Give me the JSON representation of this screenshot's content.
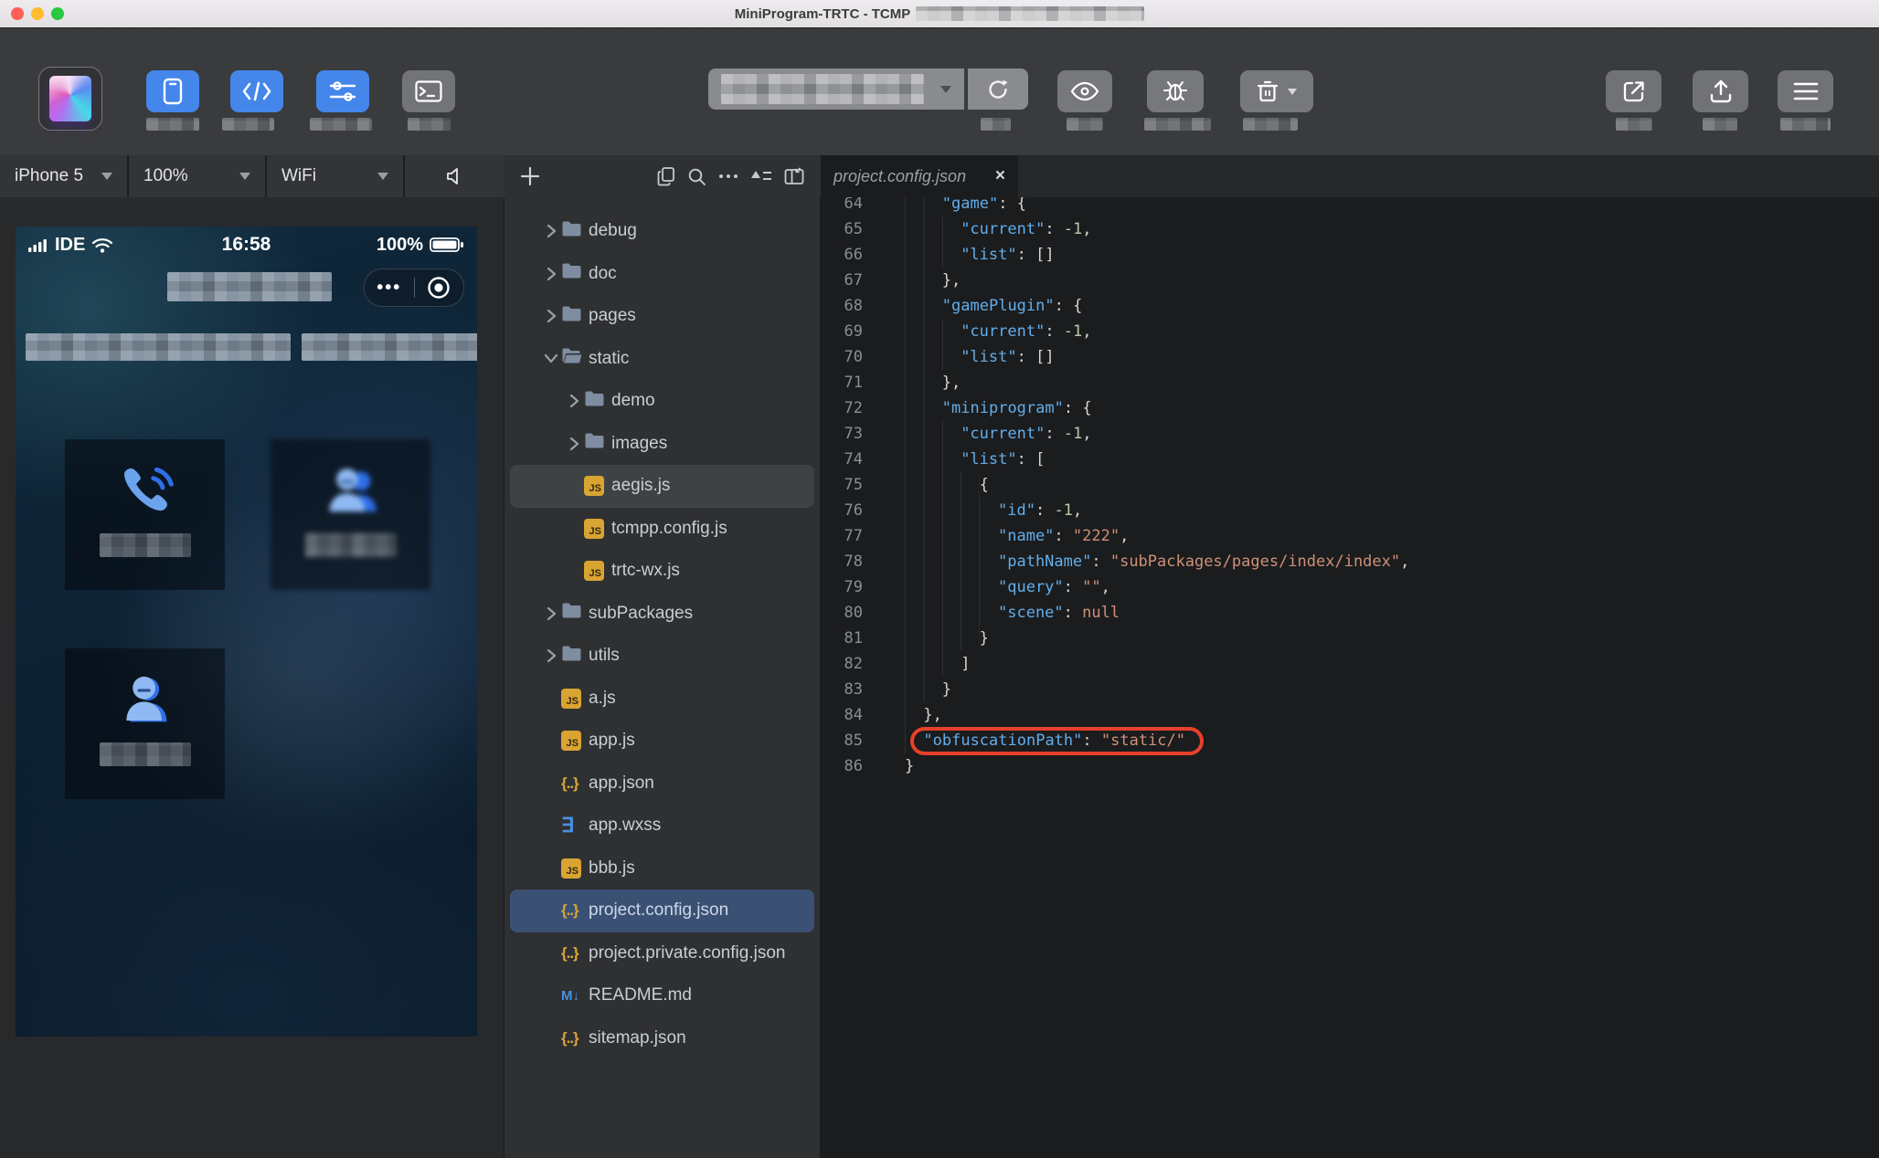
{
  "window": {
    "title": "MiniProgram-TRTC - TCMP",
    "traffic_lights": [
      "close",
      "minimize",
      "zoom"
    ]
  },
  "colors": {
    "accent_blue": "#4486ea",
    "annotation_red": "#e8402a",
    "selection_blue": "#3b5174",
    "selection_gray": "#3f4245",
    "js_icon_yellow": "#d9a432",
    "file_icon_blue": "#4a8fe2",
    "key_blue": "#62aeea",
    "string_orange": "#ce9178",
    "number_green": "#b5cea8",
    "editor_bg": "#1b1c1e",
    "toolbar_bg": "#3a3b3d"
  },
  "toolbar": {
    "buttons_left": [
      {
        "icon": "phone-icon",
        "style": "blue"
      },
      {
        "icon": "code-icon",
        "style": "blue"
      },
      {
        "icon": "sliders-icon",
        "style": "blue"
      },
      {
        "icon": "terminal-icon",
        "style": "gray"
      }
    ],
    "compile_dropdown": {
      "value": "",
      "redacted": true
    },
    "buttons_middle": [
      {
        "icon": "refresh-icon"
      },
      {
        "icon": "eye-icon"
      },
      {
        "icon": "bug-icon"
      },
      {
        "icon": "trash-icon",
        "has_caret": true
      }
    ],
    "buttons_right": [
      {
        "icon": "external-link-icon"
      },
      {
        "icon": "upload-icon"
      },
      {
        "icon": "menu-icon"
      }
    ]
  },
  "simulator": {
    "device": "iPhone 5",
    "zoom": "100%",
    "network": "WiFi",
    "status": {
      "carrier": "IDE",
      "time": "16:58",
      "battery": "100%"
    },
    "capsule": {
      "more": "•••",
      "close": "target"
    },
    "tiles": [
      {
        "icon": "call-icon"
      },
      {
        "icon": "group-icon",
        "blurred": true
      },
      {
        "icon": "person-icon"
      }
    ]
  },
  "explorer": {
    "toolbar_icons": [
      "plus-icon",
      "copy-icon",
      "search-icon",
      "more-icon",
      "collapse-icon",
      "panel-icon"
    ],
    "items": [
      {
        "label": "debug",
        "type": "folder",
        "depth": 1,
        "expandable": true
      },
      {
        "label": "doc",
        "type": "folder",
        "depth": 1,
        "expandable": true
      },
      {
        "label": "pages",
        "type": "folder",
        "depth": 1,
        "expandable": true
      },
      {
        "label": "static",
        "type": "folder-open",
        "depth": 1,
        "expandable": true,
        "expanded": true
      },
      {
        "label": "demo",
        "type": "folder",
        "depth": 2,
        "expandable": true
      },
      {
        "label": "images",
        "type": "folder",
        "depth": 2,
        "expandable": true
      },
      {
        "label": "aegis.js",
        "type": "js",
        "depth": 2,
        "selected": "gray"
      },
      {
        "label": "tcmpp.config.js",
        "type": "js",
        "depth": 2
      },
      {
        "label": "trtc-wx.js",
        "type": "js",
        "depth": 2
      },
      {
        "label": "subPackages",
        "type": "folder",
        "depth": 1,
        "expandable": true
      },
      {
        "label": "utils",
        "type": "folder",
        "depth": 1,
        "expandable": true
      },
      {
        "label": "a.js",
        "type": "js",
        "depth": 1
      },
      {
        "label": "app.js",
        "type": "js",
        "depth": 1
      },
      {
        "label": "app.json",
        "type": "json",
        "depth": 1
      },
      {
        "label": "app.wxss",
        "type": "wxss",
        "depth": 1
      },
      {
        "label": "bbb.js",
        "type": "js",
        "depth": 1
      },
      {
        "label": "project.config.json",
        "type": "json",
        "depth": 1,
        "selected": "blue"
      },
      {
        "label": "project.private.config.json",
        "type": "json",
        "depth": 1
      },
      {
        "label": "README.md",
        "type": "md",
        "depth": 1
      },
      {
        "label": "sitemap.json",
        "type": "json",
        "depth": 1
      }
    ]
  },
  "editor": {
    "tab": {
      "label": "project.config.json",
      "close": "×"
    },
    "annotated_line": 85,
    "lines": [
      {
        "n": 64,
        "indent": 4,
        "tokens": [
          [
            "k",
            "\"game\""
          ],
          [
            "p",
            ": {"
          ]
        ]
      },
      {
        "n": 65,
        "indent": 6,
        "tokens": [
          [
            "k",
            "\"current\""
          ],
          [
            "p",
            ": "
          ],
          [
            "n",
            "-1"
          ],
          [
            "p",
            ","
          ]
        ]
      },
      {
        "n": 66,
        "indent": 6,
        "tokens": [
          [
            "k",
            "\"list\""
          ],
          [
            "p",
            ": []"
          ]
        ]
      },
      {
        "n": 67,
        "indent": 4,
        "tokens": [
          [
            "p",
            "},"
          ]
        ]
      },
      {
        "n": 68,
        "indent": 4,
        "tokens": [
          [
            "k",
            "\"gamePlugin\""
          ],
          [
            "p",
            ": {"
          ]
        ]
      },
      {
        "n": 69,
        "indent": 6,
        "tokens": [
          [
            "k",
            "\"current\""
          ],
          [
            "p",
            ": "
          ],
          [
            "n",
            "-1"
          ],
          [
            "p",
            ","
          ]
        ]
      },
      {
        "n": 70,
        "indent": 6,
        "tokens": [
          [
            "k",
            "\"list\""
          ],
          [
            "p",
            ": []"
          ]
        ]
      },
      {
        "n": 71,
        "indent": 4,
        "tokens": [
          [
            "p",
            "},"
          ]
        ]
      },
      {
        "n": 72,
        "indent": 4,
        "tokens": [
          [
            "k",
            "\"miniprogram\""
          ],
          [
            "p",
            ": {"
          ]
        ]
      },
      {
        "n": 73,
        "indent": 6,
        "tokens": [
          [
            "k",
            "\"current\""
          ],
          [
            "p",
            ": "
          ],
          [
            "n",
            "-1"
          ],
          [
            "p",
            ","
          ]
        ]
      },
      {
        "n": 74,
        "indent": 6,
        "tokens": [
          [
            "k",
            "\"list\""
          ],
          [
            "p",
            ": ["
          ]
        ]
      },
      {
        "n": 75,
        "indent": 8,
        "tokens": [
          [
            "p",
            "{"
          ]
        ]
      },
      {
        "n": 76,
        "indent": 10,
        "tokens": [
          [
            "k",
            "\"id\""
          ],
          [
            "p",
            ": "
          ],
          [
            "n",
            "-1"
          ],
          [
            "p",
            ","
          ]
        ]
      },
      {
        "n": 77,
        "indent": 10,
        "tokens": [
          [
            "k",
            "\"name\""
          ],
          [
            "p",
            ": "
          ],
          [
            "s",
            "\"222\""
          ],
          [
            "p",
            ","
          ]
        ]
      },
      {
        "n": 78,
        "indent": 10,
        "tokens": [
          [
            "k",
            "\"pathName\""
          ],
          [
            "p",
            ": "
          ],
          [
            "s",
            "\"subPackages/pages/index/index\""
          ],
          [
            "p",
            ","
          ]
        ]
      },
      {
        "n": 79,
        "indent": 10,
        "tokens": [
          [
            "k",
            "\"query\""
          ],
          [
            "p",
            ": "
          ],
          [
            "s",
            "\"\""
          ],
          [
            "p",
            ","
          ]
        ]
      },
      {
        "n": 80,
        "indent": 10,
        "tokens": [
          [
            "k",
            "\"scene\""
          ],
          [
            "p",
            ": "
          ],
          [
            "u",
            "null"
          ]
        ]
      },
      {
        "n": 81,
        "indent": 8,
        "tokens": [
          [
            "p",
            "}"
          ]
        ]
      },
      {
        "n": 82,
        "indent": 6,
        "tokens": [
          [
            "p",
            "]"
          ]
        ]
      },
      {
        "n": 83,
        "indent": 4,
        "tokens": [
          [
            "p",
            "}"
          ]
        ]
      },
      {
        "n": 84,
        "indent": 2,
        "tokens": [
          [
            "p",
            "},"
          ]
        ]
      },
      {
        "n": 85,
        "indent": 2,
        "tokens": [
          [
            "k",
            "\"obfuscationPath\""
          ],
          [
            "p",
            ": "
          ],
          [
            "s",
            "\"static/\""
          ]
        ],
        "annotated": true
      },
      {
        "n": 86,
        "indent": 0,
        "tokens": [
          [
            "p",
            "}"
          ]
        ]
      }
    ]
  }
}
